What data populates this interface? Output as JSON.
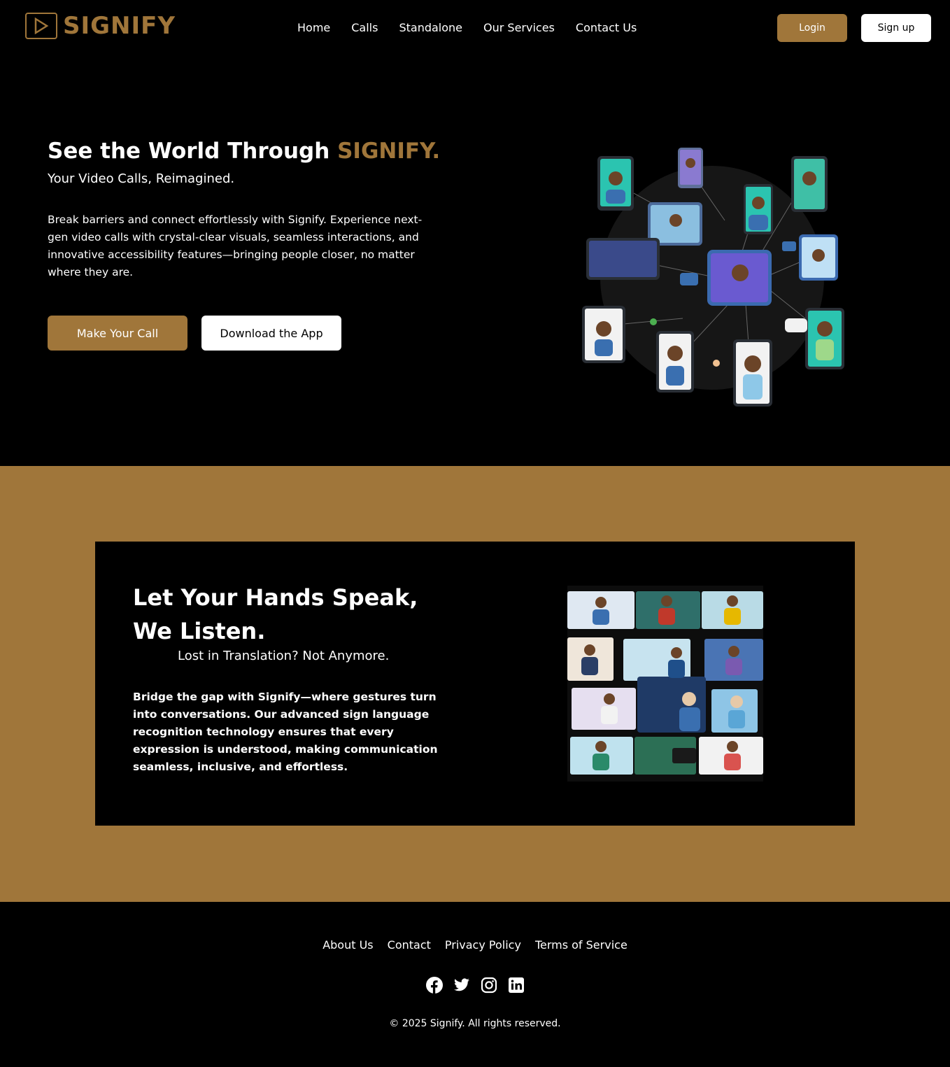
{
  "brand": {
    "name": "SIGNIFY",
    "accent_color": "#a0763a"
  },
  "nav": {
    "links": [
      "Home",
      "Calls",
      "Standalone",
      "Our Services",
      "Contact Us"
    ],
    "login_label": "Login",
    "signup_label": "Sign up"
  },
  "hero": {
    "title_prefix": "See the World Through ",
    "title_accent": "SIGNIFY.",
    "subtitle": "Your Video Calls, Reimagined.",
    "body": "Break barriers and connect effortlessly with Signify. Experience next-gen video calls with crystal-clear visuals, seamless interactions, and innovative accessibility features—bringing people closer, no matter where they are.",
    "primary_button": "Make Your Call",
    "secondary_button": "Download the App",
    "illustration": "video-call-network-illustration"
  },
  "feature": {
    "title": "Let Your Hands Speak, We Listen.",
    "subtitle": "Lost in Translation? Not Anymore.",
    "body": "Bridge the gap with Signify—where gestures turn into conversations. Our advanced sign language recognition technology ensures that every expression is understood, making communication seamless, inclusive, and effortless.",
    "illustration": "sign-language-video-grid-illustration"
  },
  "footer": {
    "links": [
      "About Us",
      "Contact",
      "Privacy Policy",
      "Terms of Service"
    ],
    "socials": [
      "facebook-icon",
      "twitter-icon",
      "instagram-icon",
      "linkedin-icon"
    ],
    "copyright": "© 2025 Signify. All rights reserved."
  }
}
